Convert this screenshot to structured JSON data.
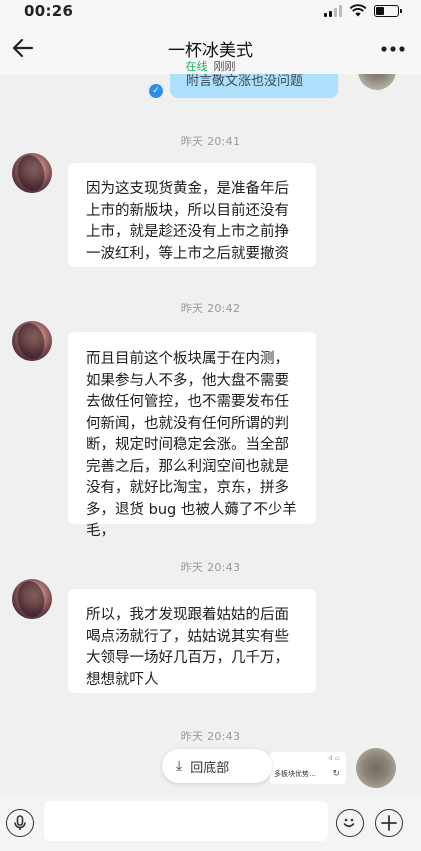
{
  "status_bar": {
    "time": "00:26"
  },
  "header": {
    "title": "一杯冰美式",
    "status_online": "在线",
    "status_seen": "刚刚"
  },
  "top_partial_message": {
    "text": "附言敬文涨也没问题"
  },
  "messages": [
    {
      "timestamp": "昨天 20:41",
      "lines": [
        "因为这支现货黄金，是准备年后",
        "上市的新版块，所以目前还没有",
        "上市，就是趁还没有上市之前挣",
        "一波红利，等上市之后就要撤资"
      ]
    },
    {
      "timestamp": "昨天 20:42",
      "lines": [
        "而且目前这个板块属于在内测，",
        "如果参与人不多，他大盘不需要",
        "去做任何管控，也不需要发布任",
        "何新闻，也就没有任何所谓的判",
        "断，规定时间稳定会涨。当全部",
        "完善之后，那么利润空间也就是",
        "没有，就好比淘宝，京东，拼多",
        "多，退货 bug 也被人薅了不少羊",
        "毛，"
      ]
    },
    {
      "timestamp": "昨天 20:43",
      "lines": [
        "所以，我才发现跟着姑姑的后面",
        "喝点汤就行了，姑姑说其实有些",
        "大领导一场好几百万，几千万，",
        "想想就吓人"
      ]
    }
  ],
  "last_timestamp": "昨天 20:43",
  "scroll_bottom": {
    "label": "回底部"
  },
  "preview_card": {
    "text": "多板块优势…"
  },
  "icons": {
    "back": "arrow-left-icon",
    "more": "more-dots-icon",
    "mic": "microphone-icon",
    "emoji": "emoji-icon",
    "plus": "plus-icon",
    "read": "check-icon"
  }
}
